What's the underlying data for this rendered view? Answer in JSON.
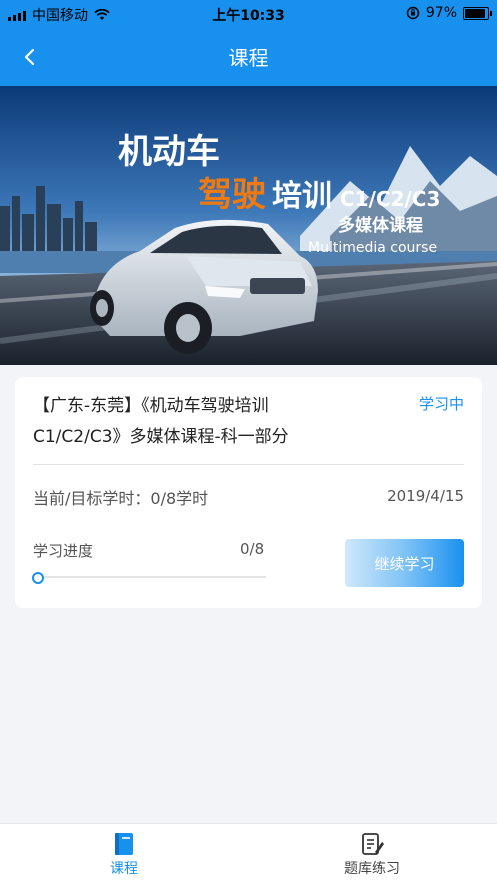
{
  "status_bar": {
    "carrier": "中国移动",
    "time": "上午10:33",
    "battery": "97%"
  },
  "nav": {
    "title": "课程"
  },
  "banner": {
    "line1": "机动车",
    "line2a": "驾驶",
    "line2b": "培训",
    "line2c": "C1/C2/C3",
    "line3": "多媒体课程",
    "line4": "Multimedia course"
  },
  "course": {
    "title_line1": "【广东-东莞】《机动车驾驶培训",
    "title_line2": "C1/C2/C3》多媒体课程-科一部分",
    "status": "学习中",
    "hours_label": "当前/目标学时：0/8学时",
    "date": "2019/4/15",
    "progress_label": "学习进度",
    "progress_value": "0/8",
    "progress_fraction": 0,
    "button": "继续学习"
  },
  "tabs": [
    {
      "label": "课程",
      "icon": "book-icon",
      "active": true
    },
    {
      "label": "题库练习",
      "icon": "notepad-icon",
      "active": false
    }
  ],
  "colors": {
    "primary": "#1790ee",
    "background": "#f3f4f8",
    "banner_orange": "#f07a12"
  }
}
